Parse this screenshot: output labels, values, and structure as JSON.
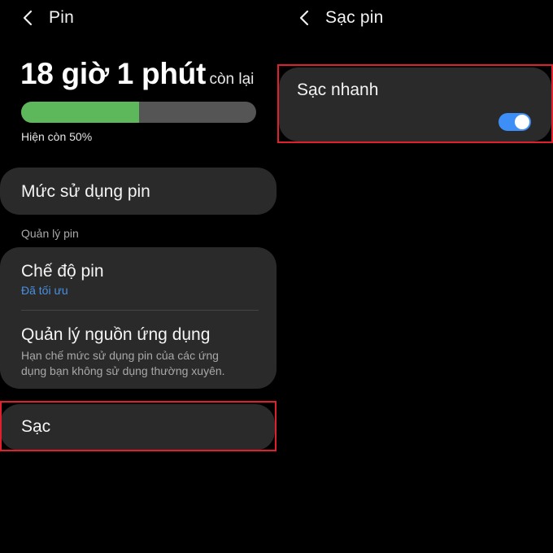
{
  "left_panel": {
    "title": "Pin",
    "battery_time": "18 giờ 1 phút",
    "battery_time_suffix": "còn lại",
    "battery_level": 0.5,
    "battery_percent_text": "Hiện còn 50%",
    "usage_item": "Mức sử dụng pin",
    "section_label": "Quản lý pin",
    "battery_mode": {
      "title": "Chế độ pin",
      "subtitle": "Đã tối ưu"
    },
    "app_power": {
      "title": "Quản lý nguồn ứng dụng",
      "subtitle_line1": "Hạn chế mức sử dụng pin của các ứng",
      "subtitle_line2": "dụng bạn không sử dụng thường xuyên."
    },
    "charging_item": "Sạc"
  },
  "right_panel": {
    "title": "Sạc pin",
    "fast_charging": {
      "label": "Sạc nhanh",
      "enabled": true
    }
  },
  "colors": {
    "background": "#000000",
    "card": "#2a2a2a",
    "battery_fill": "#5cb85a",
    "toggle_on": "#3e8ef7",
    "link_blue": "#4a90e2",
    "highlight": "#e0202c"
  }
}
